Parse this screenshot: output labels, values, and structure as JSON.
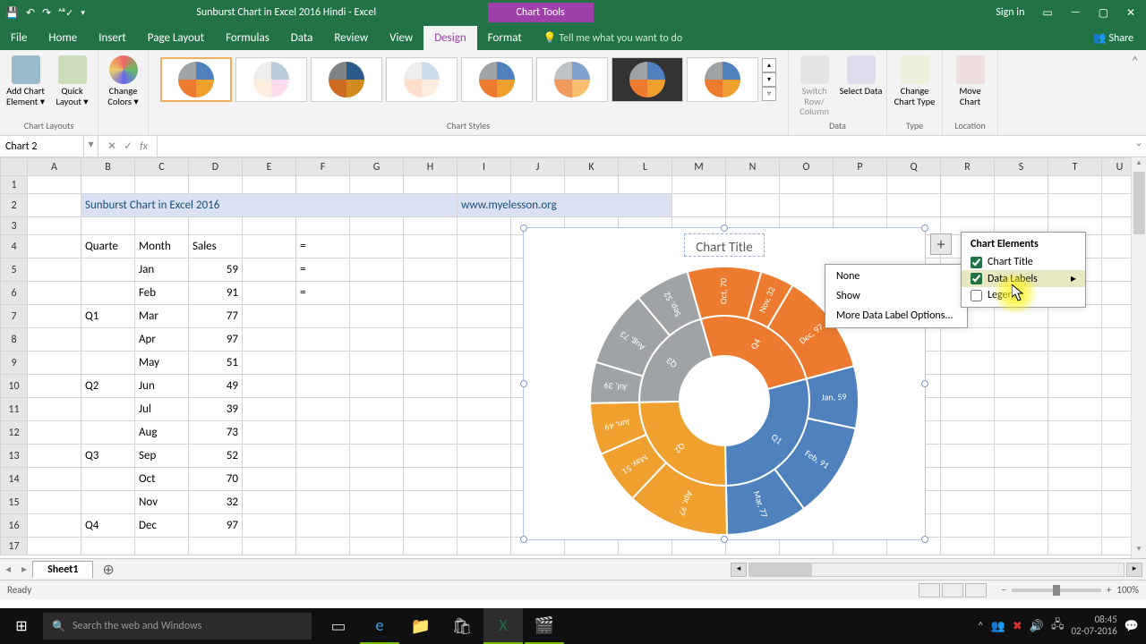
{
  "app": {
    "title": "Sunburst Chart in Excel 2016 Hindi - Excel",
    "tool_context": "Chart Tools",
    "signin": "Sign in"
  },
  "tabs": {
    "file": "File",
    "home": "Home",
    "insert": "Insert",
    "page_layout": "Page Layout",
    "formulas": "Formulas",
    "data": "Data",
    "review": "Review",
    "view": "View",
    "design": "Design",
    "format": "Format",
    "tell_me": "Tell me what you want to do",
    "share": "Share"
  },
  "ribbon": {
    "chart_layouts": "Chart Layouts",
    "add_chart_element": "Add Chart Element",
    "quick_layout": "Quick Layout",
    "change_colors": "Change Colors",
    "chart_styles": "Chart Styles",
    "switch_row_col": "Switch Row/ Column",
    "select_data": "Select Data",
    "data": "Data",
    "change_chart_type": "Change Chart Type",
    "type": "Type",
    "move_chart": "Move Chart",
    "location": "Location"
  },
  "name_box": "Chart 2",
  "fx_label": "fx",
  "columns": [
    "A",
    "B",
    "C",
    "D",
    "E",
    "F",
    "G",
    "H",
    "I",
    "J",
    "K",
    "L",
    "M",
    "N",
    "O",
    "P",
    "Q",
    "R",
    "S",
    "T",
    "U"
  ],
  "rows_visible": 17,
  "title_cell": "Sunburst Chart in Excel 2016",
  "url_cell": "www.myelesson.org",
  "table": {
    "headers": {
      "quarter": "Quarte",
      "month": "Month",
      "sales": "Sales"
    },
    "rows": [
      {
        "quarter": "",
        "month": "Jan",
        "sales": 59
      },
      {
        "quarter": "",
        "month": "Feb",
        "sales": 91
      },
      {
        "quarter": "Q1",
        "month": "Mar",
        "sales": 77
      },
      {
        "quarter": "",
        "month": "Apr",
        "sales": 97
      },
      {
        "quarter": "",
        "month": "May",
        "sales": 51
      },
      {
        "quarter": "Q2",
        "month": "Jun",
        "sales": 49
      },
      {
        "quarter": "",
        "month": "Jul",
        "sales": 39
      },
      {
        "quarter": "",
        "month": "Aug",
        "sales": 73
      },
      {
        "quarter": "Q3",
        "month": "Sep",
        "sales": 52
      },
      {
        "quarter": "",
        "month": "Oct",
        "sales": 70
      },
      {
        "quarter": "",
        "month": "Nov",
        "sales": 32
      },
      {
        "quarter": "Q4",
        "month": "Dec",
        "sales": 97
      }
    ]
  },
  "eq_marks": [
    "=",
    "=",
    "="
  ],
  "chart": {
    "title": "Chart Title",
    "elements_header": "Chart Elements",
    "el_chart_title": "Chart Title",
    "el_data_labels": "Data Labels",
    "el_legend": "Legend",
    "sub_none": "None",
    "sub_show": "Show",
    "sub_more": "More Data Label Options..."
  },
  "chart_data": {
    "type": "sunburst",
    "title": "Chart Title",
    "hierarchy": [
      {
        "quarter": "Q1",
        "color": "#4e81bd",
        "months": [
          {
            "name": "Jan",
            "value": 59
          },
          {
            "name": "Feb",
            "value": 91
          },
          {
            "name": "Mar",
            "value": 77
          }
        ]
      },
      {
        "quarter": "Q2",
        "color": "#f0a02e",
        "months": [
          {
            "name": "Apr",
            "value": 97
          },
          {
            "name": "May",
            "value": 51
          },
          {
            "name": "Jun",
            "value": 49
          }
        ]
      },
      {
        "quarter": "Q3",
        "color": "#9fa3a6",
        "months": [
          {
            "name": "Jul",
            "value": 39
          },
          {
            "name": "Aug",
            "value": 73
          },
          {
            "name": "Sep",
            "value": 52
          }
        ]
      },
      {
        "quarter": "Q4",
        "color": "#ec7a2f",
        "months": [
          {
            "name": "Oct",
            "value": 70
          },
          {
            "name": "Nov",
            "value": 32
          },
          {
            "name": "Dec",
            "value": 97
          }
        ]
      }
    ]
  },
  "sheet_tab": "Sheet1",
  "status": "Ready",
  "zoom": "100%",
  "taskbar": {
    "search_placeholder": "Search the web and Windows",
    "time": "08:45",
    "date": "02-07-2016"
  }
}
